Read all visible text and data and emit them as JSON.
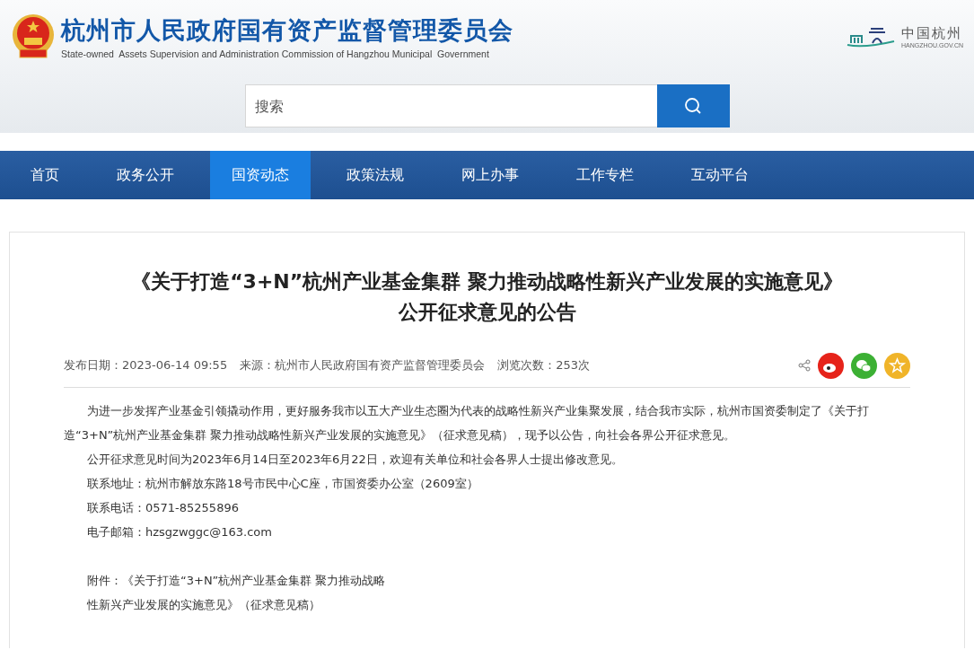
{
  "header": {
    "title": "杭州市人民政府国有资产监督管理委员会",
    "subtitle": "State-owned  Assets Supervision and Administration Commission of Hangzhou Municipal  Government",
    "city_logo": {
      "name": "中国杭州",
      "domain": "HANGZHOU.GOV.CN"
    }
  },
  "search": {
    "placeholder": "搜索"
  },
  "nav": [
    {
      "label": "首页",
      "selected": false
    },
    {
      "label": "政务公开",
      "selected": false
    },
    {
      "label": "国资动态",
      "selected": true
    },
    {
      "label": "政策法规",
      "selected": false
    },
    {
      "label": "网上办事",
      "selected": false
    },
    {
      "label": "工作专栏",
      "selected": false
    },
    {
      "label": "互动平台",
      "selected": false
    }
  ],
  "article": {
    "title_lines": [
      "《关于打造“3+N”杭州产业基金集群 聚力推动战略性新兴产业发展的实施意见》",
      "公开征求意见的公告"
    ],
    "meta": [
      "发布日期：2023-06-14 09:55",
      "来源：杭州市人民政府国有资产监督管理委员会",
      "浏览次数：253次"
    ],
    "paragraphs": [
      "为进一步发挥产业基金引领撬动作用，更好服务我市以五大产业生态圈为代表的战略性新兴产业集聚发展，结合我市实际，杭州市国资委制定了《关于打造“3+N”杭州产业基金集群 聚力推动战略性新兴产业发展的实施意见》（征求意见稿），现予以公告，向社会各界公开征求意见。",
      "公开征求意见时间为2023年6月14日至2023年6月22日，欢迎有关单位和社会各界人士提出修改意见。",
      "联系地址：杭州市解放东路18号市民中心C座，市国资委办公室（2609室）",
      "联系电话：0571-85255896",
      "电子邮箱：hzsgzwggc@163.com"
    ],
    "attachment_lines": [
      "附件：《关于打造“3+N”杭州产业基金集群 聚力推动战略",
      "性新兴产业发展的实施意见》（征求意见稿）"
    ]
  }
}
